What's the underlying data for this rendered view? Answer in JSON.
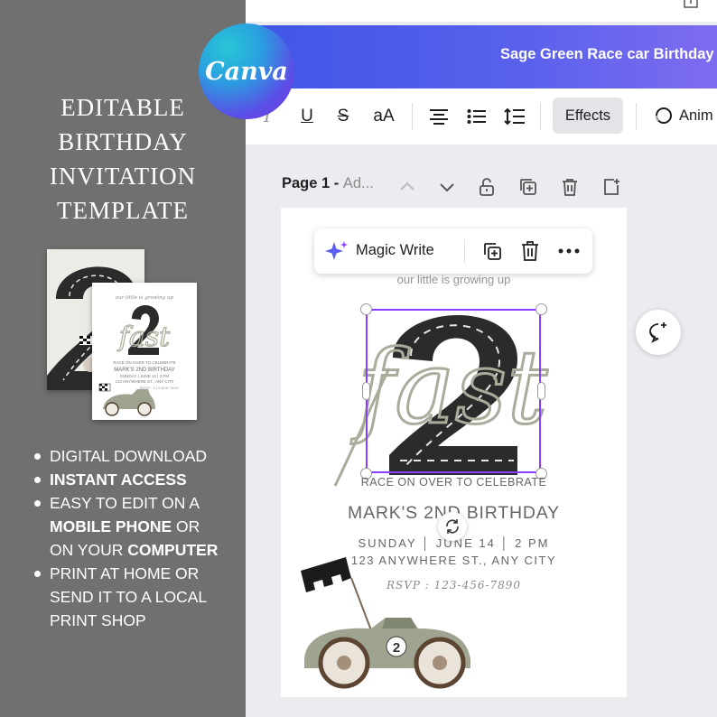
{
  "promo": {
    "title_lines": [
      "EDITABLE",
      "BIRTHDAY",
      "INVITATION",
      "TEMPLATE"
    ],
    "features": [
      {
        "pre": "DIGITAL DOWNLOAD",
        "bold": "",
        "post": ""
      },
      {
        "pre": "",
        "bold": "INSTANT ACCESS",
        "post": ""
      },
      {
        "pre": "EASY TO EDIT ON A",
        "bold": "",
        "post": ""
      },
      {
        "pre": "",
        "bold": "MOBILE PHONE",
        "post": " OR"
      },
      {
        "pre": "ON YOUR ",
        "bold": "COMPUTER",
        "post": ""
      },
      {
        "pre": "PRINT AT HOME OR",
        "bold": "",
        "post": ""
      },
      {
        "pre": "SEND IT TO A LOCAL",
        "bold": "",
        "post": ""
      },
      {
        "pre": "PRINT SHOP",
        "bold": "",
        "post": ""
      }
    ],
    "bullets_on_lines": [
      0,
      1,
      2,
      5
    ],
    "mini_front": {
      "top": "our little is growing up",
      "fast": "fast",
      "race": "RACE ON OVER TO CELEBRATE",
      "name": "MARK'S 2ND BIRTHDAY",
      "date": "SUNDAY | JUNE 14 | 2 PM",
      "addr": "123 ANYWHERE ST., ANY CITY",
      "rsvp": "RSVP : 123-456-7890"
    }
  },
  "logo": {
    "text": "Canva"
  },
  "editor": {
    "doc_title": "Sage Green Race car Birthday",
    "toolbar": {
      "italic": "I",
      "underline": "U",
      "strike": "S",
      "case": "aA",
      "effects": "Effects",
      "animate": "Anim"
    },
    "pagebar": {
      "page": "Page 1",
      "dash": " - ",
      "title": "Ad..."
    },
    "floating": {
      "magic_write": "Magic Write"
    },
    "invitation": {
      "top_text": "our little is growing up",
      "big_number": "2",
      "script_word": "fast",
      "race": "RACE ON OVER TO CELEBRATE",
      "name": "MARK'S 2ND BIRTHDAY",
      "date": "SUNDAY │ JUNE 14 │ 2 PM",
      "addr": "123 ANYWHERE ST., ANY CITY",
      "rsvp": "RSVP : 123-456-7890",
      "car_number": "2"
    }
  },
  "colors": {
    "promo_bg": "#707070",
    "accent_purple": "#8b3dff",
    "title_gradient_start": "#3f55e6",
    "title_gradient_end": "#7e6cf0",
    "sage": "#a7ad9a",
    "road": "#2b2b2b"
  }
}
